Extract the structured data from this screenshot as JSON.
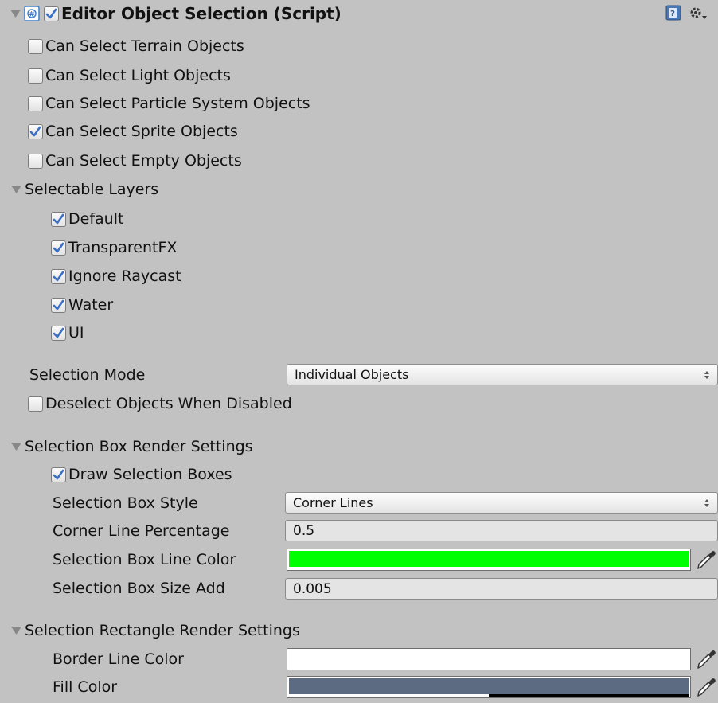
{
  "component": {
    "title": "Editor Object Selection (Script)",
    "enabled": true,
    "icons": [
      "script-icon",
      "help-book-icon",
      "gear-icon"
    ]
  },
  "toggles": [
    {
      "label": "Can Select Terrain Objects",
      "checked": false
    },
    {
      "label": "Can Select Light Objects",
      "checked": false
    },
    {
      "label": "Can Select Particle System Objects",
      "checked": false
    },
    {
      "label": "Can Select Sprite Objects",
      "checked": true
    },
    {
      "label": "Can Select Empty Objects",
      "checked": false
    }
  ],
  "layers": {
    "label": "Selectable Layers",
    "expanded": true,
    "items": [
      {
        "label": "Default",
        "checked": true
      },
      {
        "label": "TransparentFX",
        "checked": true
      },
      {
        "label": "Ignore Raycast",
        "checked": true
      },
      {
        "label": "Water",
        "checked": true
      },
      {
        "label": "UI",
        "checked": true
      }
    ]
  },
  "selection_mode": {
    "label": "Selection Mode",
    "value": "Individual Objects"
  },
  "deselect": {
    "label": "Deselect Objects When Disabled",
    "checked": false
  },
  "box_settings": {
    "label": "Selection Box Render Settings",
    "expanded": true,
    "draw": {
      "label": "Draw Selection Boxes",
      "checked": true
    },
    "style": {
      "label": "Selection Box Style",
      "value": "Corner Lines"
    },
    "corner_pct": {
      "label": "Corner Line Percentage",
      "value": "0.5"
    },
    "line_color": {
      "label": "Selection Box Line Color",
      "color": "#00ff00",
      "alpha": 1.0
    },
    "size_add": {
      "label": "Selection Box Size Add",
      "value": "0.005"
    }
  },
  "rect_settings": {
    "label": "Selection Rectangle Render Settings",
    "expanded": true,
    "border_color": {
      "label": "Border Line Color",
      "color": "#ffffff",
      "alpha": 1.0
    },
    "fill_color": {
      "label": "Fill Color",
      "color": "#5c6a82",
      "alpha": 0.5
    }
  },
  "colors": {
    "background": "#c2c2c2",
    "checkmark": "#3a6fc4",
    "foldout": "#7f7f7f"
  }
}
